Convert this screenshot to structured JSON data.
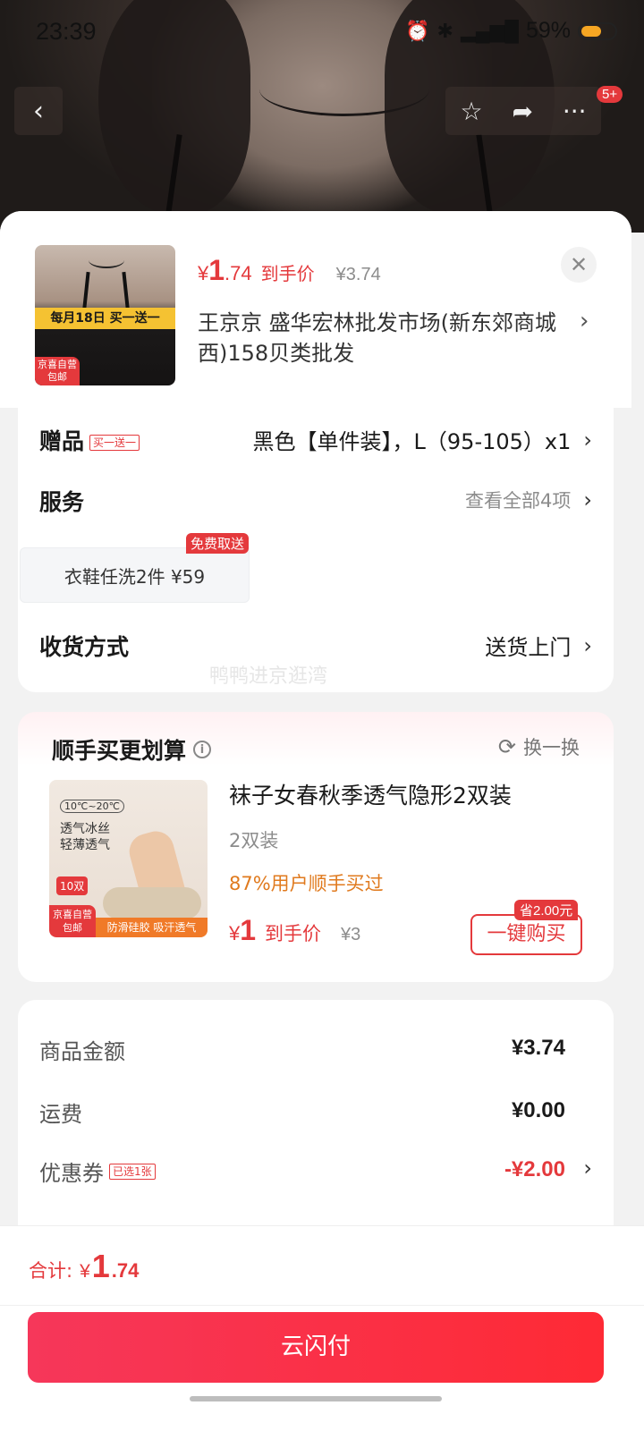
{
  "status_bar": {
    "time": "23:39",
    "battery": "59%"
  },
  "nav": {
    "badge": "5+"
  },
  "product": {
    "thumb_promo": "每月18日 买一送一",
    "thumb_tag": "京喜自营 包邮",
    "price_yen": "¥",
    "price_int": "1",
    "price_dec": ".74",
    "price_label": "到手价",
    "orig_price": "¥3.74",
    "shop": "王京京  盛华宏林批发市场(新东郊商城西)158贝类批发"
  },
  "options": {
    "gift_title": "赠品",
    "gift_tag": "买一送一",
    "gift_value": "黑色【单件装】，L（95-105）x1",
    "service_title": "服务",
    "service_value": "查看全部4项",
    "service_chip": "衣鞋任洗2件  ¥59",
    "service_badge": "免费取送",
    "delivery_title": "收货方式",
    "delivery_value": "送货上门",
    "watermark": "鸭鸭进京逛湾"
  },
  "recommend": {
    "title": "顺手买更划算",
    "swap": "换一换",
    "thumb_temp": "10℃~20℃",
    "thumb_text": "透气冰丝\n轻薄透气",
    "thumb_badge": "10双",
    "thumb_tag": "京喜自营 包邮",
    "thumb_features": "防滑硅胶  吸汗透气",
    "name": "袜子女春秋季透气隐形2双装",
    "spec": "2双装",
    "percent": "87%用户顺手买过",
    "price_yen": "¥",
    "price_int": "1",
    "price_label": "到手价",
    "orig_price": "¥3",
    "buy": "一键购买",
    "save": "省2.00元"
  },
  "summary": {
    "goods_label": "商品金额",
    "goods_value": "¥3.74",
    "shipping_label": "运费",
    "shipping_value": "¥0.00",
    "coupon_label": "优惠券",
    "coupon_tag": "已选1张",
    "coupon_value": "-¥2.00"
  },
  "footer": {
    "total_label": "合计:",
    "total_yen": "¥",
    "total_int": "1",
    "total_dec": ".74",
    "pay_label": "云闪付"
  },
  "colors": {
    "accent": "#e4393c",
    "orange": "#e07a1e",
    "pay_gradient_start": "#f6375a",
    "pay_gradient_end": "#fe2a35"
  }
}
